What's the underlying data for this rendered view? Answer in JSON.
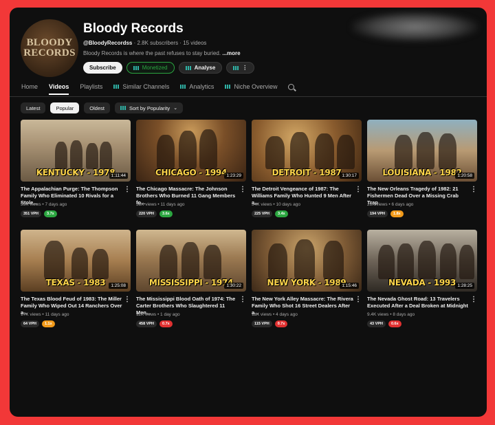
{
  "channel": {
    "avatar_text_1": "BLOODY",
    "avatar_text_2": "RECORDS",
    "name": "Bloody Records",
    "handle": "@BloodyRecordss",
    "stats": "· 2.8K subscribers · 15 videos",
    "description": "Bloody Records is where the past refuses to stay buried.",
    "more_label": "...more"
  },
  "actions": {
    "subscribe": "Subscribe",
    "monetized": "Monetized",
    "analyse": "Analyse",
    "more": "⋮"
  },
  "tabs": [
    {
      "label": "Home"
    },
    {
      "label": "Videos"
    },
    {
      "label": "Playlists"
    },
    {
      "label": "Similar Channels"
    },
    {
      "label": "Analytics"
    },
    {
      "label": "Niche Overview"
    }
  ],
  "filters": {
    "latest": "Latest",
    "popular": "Popular",
    "oldest": "Oldest",
    "sort": "Sort by Popularity"
  },
  "videos": [
    {
      "location": "KENTUCKY - 1978",
      "duration": "1:11:44",
      "title": "The Appalachian Purge: The Thompson Family Who Eliminated 10 Rivals for a Stole...",
      "meta": "59K views • 7 days ago",
      "vph": "351 VPH",
      "ratio": "3.7x",
      "ratio_color": "green"
    },
    {
      "location": "CHICAGO - 1994",
      "duration": "1:23:29",
      "title": "The Chicago Massacre: The Johnson Brothers Who Burned 11 Gang Members fo...",
      "meta": "58K views • 11 days ago",
      "vph": "220 VPH",
      "ratio": "3.6x",
      "ratio_color": "green"
    },
    {
      "location": "DETROIT - 1987",
      "duration": "1:30:17",
      "title": "The Detroit Vengeance of 1987: The Williams Family Who Hunted 9 Men After a...",
      "meta": "54K views • 10 days ago",
      "vph": "225 VPH",
      "ratio": "3.4x",
      "ratio_color": "green"
    },
    {
      "location": "LOUISIANA - 1982",
      "duration": "1:20:58",
      "title": "The New Orleans Tragedy of 1982: 21 Fishermen Dead Over a Missing Crab Trap",
      "meta": "28K views • 6 days ago",
      "vph": "194 VPH",
      "ratio": "1.8x",
      "ratio_color": "orange"
    },
    {
      "location": "TEXAS - 1983",
      "duration": "1:25:08",
      "title": "The Texas Blood Feud of 1983: The Miller Family Who Wiped Out 14 Ranchers Over a...",
      "meta": "17K views • 11 days ago",
      "vph": "64 VPH",
      "ratio": "1.1x",
      "ratio_color": "orange"
    },
    {
      "location": "MISSISSIPPI - 1974",
      "duration": "1:30:22",
      "title": "The Mississippi Blood Oath of 1974: The Carter Brothers Who Slaughtered 11 Men...",
      "meta": "11K views • 1 day ago",
      "vph": "458 VPH",
      "ratio": "0.7x",
      "ratio_color": "red"
    },
    {
      "location": "NEW YORK - 1989",
      "duration": "1:15:46",
      "title": "The New York Alley Massacre: The Rivera Family Who Shot 16 Street Dealers After a...",
      "meta": "11K views • 4 days ago",
      "vph": "115 VPH",
      "ratio": "0.7x",
      "ratio_color": "red"
    },
    {
      "location": "NEVADA - 1993",
      "duration": "1:28:25",
      "title": "The Nevada Ghost Road: 13 Travelers Executed After a Deal Broken at Midnight",
      "meta": "9.4K views • 8 days ago",
      "vph": "43 VPH",
      "ratio": "0.6x",
      "ratio_color": "red"
    }
  ],
  "colors": {
    "background_border": "#f23838",
    "page": "#0f0f0f",
    "green": "#2ba640",
    "orange": "#f29a1a",
    "red": "#e03131",
    "title_yellow": "#ffd54a"
  }
}
